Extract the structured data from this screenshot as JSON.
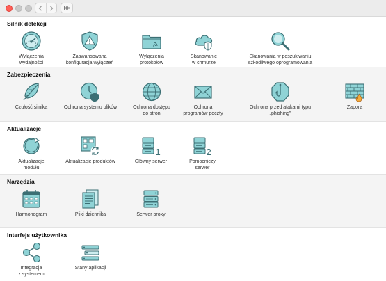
{
  "colors": {
    "icon_fill": "#8fd3d6",
    "icon_stroke": "#3c6f74",
    "accent": "#4aa8ae"
  },
  "sections": [
    {
      "title": "Silnik detekcji",
      "items": [
        {
          "label": "Wyłączenia\nwydajności",
          "icon": "gauge-icon"
        },
        {
          "label": "Zaawansowana\nkonfiguracja wyłączeń",
          "icon": "warning-shield-icon"
        },
        {
          "label": "Wyłączenia\nprotokołów",
          "icon": "folder-icon"
        },
        {
          "label": "Skanowanie\nw chmurze",
          "icon": "cloud-shield-icon"
        },
        {
          "label": "Skanowania w poszukiwaniu\nszkodliwego oprogramowania",
          "icon": "magnifier-icon"
        }
      ]
    },
    {
      "title": "Zabezpieczenia",
      "items": [
        {
          "label": "Czułość silnika",
          "icon": "feather-icon"
        },
        {
          "label": "Ochrona systemu plików",
          "icon": "clock-shield-icon"
        },
        {
          "label": "Ochrona dostępu\ndo stron",
          "icon": "globe-icon"
        },
        {
          "label": "Ochrona\nprogramów poczty",
          "icon": "envelope-icon"
        },
        {
          "label": "Ochrona przed atakami typu „phishing”",
          "icon": "fishhook-icon"
        },
        {
          "label": "Zapora",
          "icon": "firewall-icon"
        }
      ]
    },
    {
      "title": "Aktualizacje",
      "items": [
        {
          "label": "Aktualizacje\nmodułu",
          "icon": "refresh-icon"
        },
        {
          "label": "Aktualizacje produktów",
          "icon": "product-update-icon"
        },
        {
          "label": "Główny serwer",
          "icon": "server-1-icon"
        },
        {
          "label": "Pomocniczy\nserwer",
          "icon": "server-2-icon"
        }
      ]
    },
    {
      "title": "Narzędzia",
      "items": [
        {
          "label": "Harmonogram",
          "icon": "calendar-icon"
        },
        {
          "label": "Pliki dziennika",
          "icon": "log-files-icon"
        },
        {
          "label": "Serwer proxy",
          "icon": "proxy-server-icon"
        }
      ]
    },
    {
      "title": "Interfejs użytkownika",
      "items": [
        {
          "label": "Integracja\nz systemem",
          "icon": "share-nodes-icon"
        },
        {
          "label": "Stany aplikacji",
          "icon": "app-states-icon"
        }
      ]
    }
  ]
}
